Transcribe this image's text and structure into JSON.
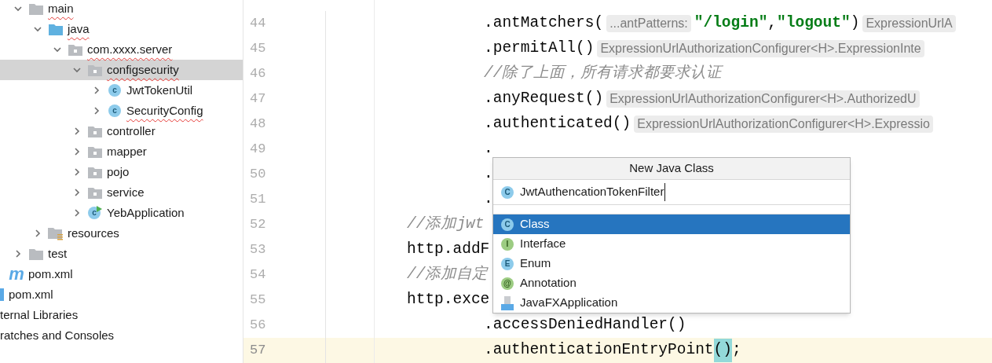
{
  "project_tree": [
    {
      "children": [
        {
          "children": [
            {
              "children": [
                {
                  "label": "main",
                  "kind": "folder",
                  "expanded": true,
                  "selected": false,
                  "misspelled": true,
                  "children": [
                    {
                      "label": "java",
                      "kind": "source-folder",
                      "expanded": true,
                      "selected": false,
                      "misspelled": true,
                      "children": [
                        {
                          "label": "com.xxxx.server",
                          "kind": "package",
                          "expanded": true,
                          "selected": false,
                          "misspelled": true,
                          "children": [
                            {
                              "label": "configsecurity",
                              "kind": "package",
                              "expanded": true,
                              "selected": true,
                              "misspelled": true,
                              "children": [
                                {
                                  "label": "JwtTokenUtil",
                                  "kind": "class",
                                  "badge": "c",
                                  "expanded": false,
                                  "selected": false,
                                  "misspelled": false
                                },
                                {
                                  "label": "SecurityConfig",
                                  "kind": "class",
                                  "badge": "c",
                                  "expanded": false,
                                  "selected": false,
                                  "misspelled": true
                                }
                              ]
                            },
                            {
                              "label": "controller",
                              "kind": "package",
                              "expanded": false,
                              "selected": false,
                              "misspelled": false
                            },
                            {
                              "label": "mapper",
                              "kind": "package",
                              "expanded": false,
                              "selected": false,
                              "misspelled": false
                            },
                            {
                              "label": "pojo",
                              "kind": "package",
                              "expanded": false,
                              "selected": false,
                              "misspelled": false
                            },
                            {
                              "label": "service",
                              "kind": "package",
                              "expanded": false,
                              "selected": false,
                              "misspelled": false
                            },
                            {
                              "label": "YebApplication",
                              "kind": "app",
                              "badge": "c",
                              "expanded": false,
                              "selected": false,
                              "misspelled": false
                            }
                          ]
                        }
                      ]
                    },
                    {
                      "label": "resources",
                      "kind": "resources",
                      "expanded": false,
                      "selected": false,
                      "misspelled": false
                    }
                  ]
                },
                {
                  "label": "test",
                  "kind": "folder",
                  "expanded": false,
                  "selected": false,
                  "misspelled": false
                }
              ]
            },
            {
              "label": "pom.xml",
              "kind": "maven",
              "badge": "m",
              "selected": false,
              "misspelled": false
            }
          ]
        },
        {
          "label": "pom.xml",
          "kind": "file",
          "selected": false,
          "misspelled": false
        }
      ]
    },
    {
      "label": "ternal Libraries",
      "kind": "text",
      "selected": false,
      "misspelled": false
    },
    {
      "label": "ratches and Consoles",
      "kind": "text",
      "selected": false,
      "misspelled": false
    }
  ],
  "editor": {
    "lines": [
      {
        "number": "44",
        "kind": "chain",
        "current": false,
        "tokens": [
          {
            "kind": "code",
            "text": ".antMatchers("
          },
          {
            "kind": "hint",
            "text": "...antPatterns:"
          },
          {
            "kind": "string",
            "text": "\"/login\""
          },
          {
            "kind": "code",
            "text": ","
          },
          {
            "kind": "string",
            "text": "\"logout\""
          },
          {
            "kind": "code",
            "text": ")"
          },
          {
            "kind": "hint",
            "text": "ExpressionUrlA"
          }
        ]
      },
      {
        "number": "45",
        "kind": "chain",
        "current": false,
        "tokens": [
          {
            "kind": "code",
            "text": ".permitAll()"
          },
          {
            "kind": "hint",
            "text": "ExpressionUrlAuthorizationConfigurer<H>.ExpressionInte"
          }
        ]
      },
      {
        "number": "46",
        "kind": "chain",
        "current": false,
        "tokens": [
          {
            "kind": "comment",
            "text": "//除了上面，所有请求都要求认证"
          }
        ]
      },
      {
        "number": "47",
        "kind": "chain",
        "current": false,
        "tokens": [
          {
            "kind": "code",
            "text": ".anyRequest()"
          },
          {
            "kind": "hint",
            "text": "ExpressionUrlAuthorizationConfigurer<H>.AuthorizedU"
          }
        ]
      },
      {
        "number": "48",
        "kind": "chain",
        "current": false,
        "tokens": [
          {
            "kind": "code",
            "text": ".authenticated()"
          },
          {
            "kind": "hint",
            "text": "ExpressionUrlAuthorizationConfigurer<H>.Expressio"
          }
        ]
      },
      {
        "number": "49",
        "kind": "chain",
        "current": false,
        "tokens": [
          {
            "kind": "code",
            "text": "."
          }
        ]
      },
      {
        "number": "50",
        "kind": "chain",
        "current": false,
        "tokens": [
          {
            "kind": "code",
            "text": "."
          }
        ]
      },
      {
        "number": "51",
        "kind": "chain",
        "current": false,
        "tokens": [
          {
            "kind": "code",
            "text": "."
          }
        ]
      },
      {
        "number": "52",
        "kind": "statement",
        "current": false,
        "tokens": [
          {
            "kind": "comment",
            "text": "//添加jwt"
          }
        ]
      },
      {
        "number": "53",
        "kind": "statement",
        "current": false,
        "tokens": [
          {
            "kind": "code",
            "text": "http.addF"
          }
        ]
      },
      {
        "number": "54",
        "kind": "statement",
        "current": false,
        "tokens": [
          {
            "kind": "comment",
            "text": "//添加自定"
          }
        ]
      },
      {
        "number": "55",
        "kind": "statement",
        "current": false,
        "tokens": [
          {
            "kind": "code",
            "text": "http.exce"
          }
        ]
      },
      {
        "number": "56",
        "kind": "chain",
        "current": false,
        "tokens": [
          {
            "kind": "code",
            "text": ".accessDeniedHandler()"
          }
        ]
      },
      {
        "number": "57",
        "kind": "chain",
        "current": true,
        "tokens": [
          {
            "kind": "code",
            "text": ".authenticationEntryPoint"
          },
          {
            "kind": "match",
            "text": "("
          },
          {
            "kind": "match",
            "text": ")"
          },
          {
            "kind": "code",
            "text": ";"
          }
        ]
      }
    ]
  },
  "dialog": {
    "title": "New Java Class",
    "name_field": {
      "badge": "C",
      "value": "JwtAuthencationTokenFilter"
    },
    "options": [
      {
        "label": "Class",
        "kind": "class",
        "badge": "C",
        "selected": true
      },
      {
        "label": "Interface",
        "kind": "interface",
        "badge": "I",
        "selected": false
      },
      {
        "label": "Enum",
        "kind": "enum",
        "badge": "E",
        "selected": false
      },
      {
        "label": "Annotation",
        "kind": "annotation",
        "badge": "@",
        "selected": false
      },
      {
        "label": "JavaFXApplication",
        "kind": "javafx",
        "selected": false
      }
    ]
  }
}
